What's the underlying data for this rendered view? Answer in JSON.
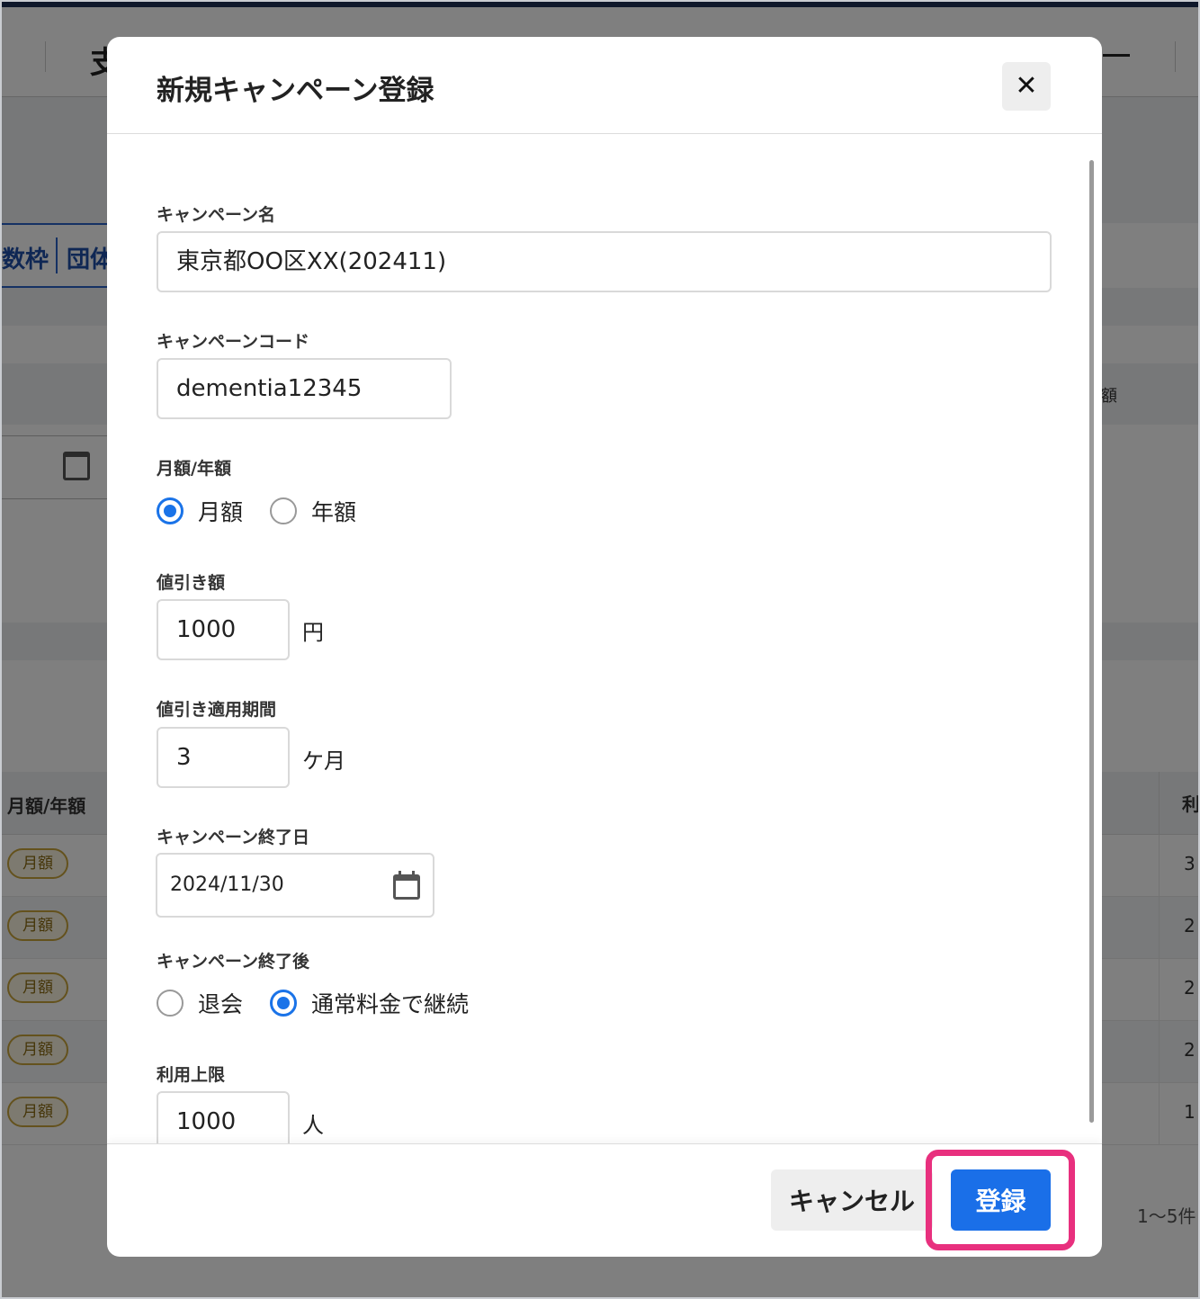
{
  "background": {
    "header_title": "支",
    "tabs": [
      "数枠",
      "団体"
    ],
    "table_header_left": "月額/年額",
    "table_header_right": "利",
    "right_col_header": "額",
    "rows": [
      {
        "badge": "月額",
        "value": "3"
      },
      {
        "badge": "月額",
        "value": "2"
      },
      {
        "badge": "月額",
        "value": "2"
      },
      {
        "badge": "月額",
        "value": "2"
      },
      {
        "badge": "月額",
        "value": "1"
      }
    ],
    "pagination": "1～5件"
  },
  "modal": {
    "title": "新規キャンペーン登録",
    "close_label": "✕",
    "fields": {
      "campaign_name": {
        "label": "キャンペーン名",
        "value": "東京都OO区XX(202411)"
      },
      "campaign_code": {
        "label": "キャンペーンコード",
        "value": "dementia12345"
      },
      "billing_cycle": {
        "label": "月額/年額",
        "options": [
          {
            "label": "月額",
            "checked": true
          },
          {
            "label": "年額",
            "checked": false
          }
        ]
      },
      "discount_amount": {
        "label": "値引き額",
        "value": "1000",
        "unit": "円"
      },
      "discount_period": {
        "label": "値引き適用期間",
        "value": "3",
        "unit": "ケ月"
      },
      "end_date": {
        "label": "キャンペーン終了日",
        "value": "2024/11/30"
      },
      "after_end": {
        "label": "キャンペーン終了後",
        "options": [
          {
            "label": "退会",
            "checked": false
          },
          {
            "label": "通常料金で継続",
            "checked": true
          }
        ]
      },
      "usage_limit": {
        "label": "利用上限",
        "value": "1000",
        "unit": "人"
      }
    },
    "footer": {
      "cancel_label": "キャンセル",
      "submit_label": "登録"
    }
  },
  "colors": {
    "primary": "#1a6fe8",
    "highlight": "#e8307e",
    "overlay": "rgba(0,0,0,0.5)"
  }
}
